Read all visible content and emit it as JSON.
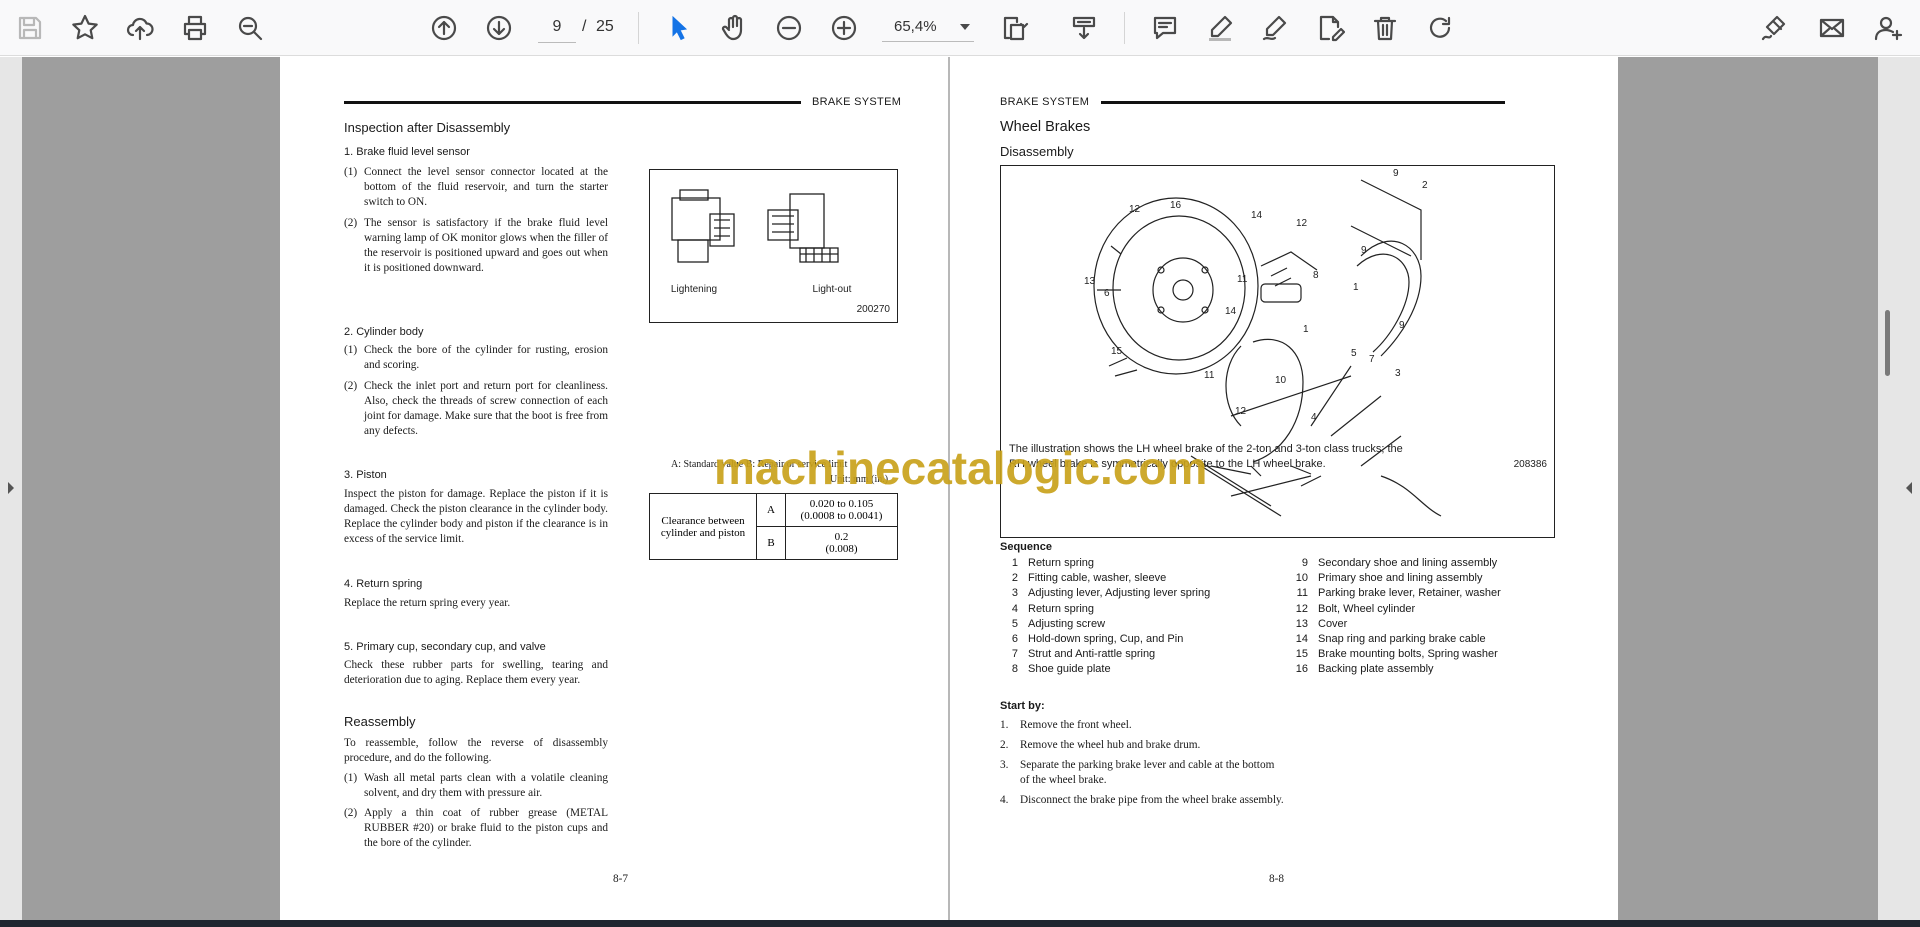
{
  "toolbar": {
    "page_current": "9",
    "page_separator": "/",
    "page_total": "25",
    "zoom": "65,4%"
  },
  "left_page": {
    "header": "BRAKE SYSTEM",
    "title": "Inspection after Disassembly",
    "s1_title": "1.   Brake fluid level sensor",
    "s1_p1_num": "(1)",
    "s1_p1": "Connect the level sensor connector located at the bottom of the fluid reservoir, and turn the starter switch to ON.",
    "s1_p2_num": "(2)",
    "s1_p2": "The sensor is satisfactory if the brake fluid level warning lamp of OK monitor glows when the filler of the reservoir is positioned upward and goes out when it is positioned downward.",
    "fig1_label_a": "Lightening",
    "fig1_label_b": "Light-out",
    "fig1_code": "200270",
    "s2_title": "2.   Cylinder body",
    "s2_p1_num": "(1)",
    "s2_p1": "Check the bore of the cylinder for rusting, erosion and scoring.",
    "s2_p2_num": "(2)",
    "s2_p2": "Check the inlet port and return port for cleanliness. Also, check the threads of screw connection of each joint for damage.  Make sure that the boot is free from any defects.",
    "s3_title": "3.   Piston",
    "s3_p": "Inspect the piston for damage.  Replace the piston if it is damaged.  Check the piston clearance in the cylinder body. Replace the cylinder body and piston if the clearance is in excess of the service limit.",
    "table_note1": "A:  Standard value    B: Repair or service limit",
    "table_note2": "Unit: mm (in.)",
    "table_label": "Clearance between cylinder and piston",
    "table_rows": [
      {
        "key": "A",
        "value1": "0.020 to 0.105",
        "value2": "(0.0008 to 0.0041)"
      },
      {
        "key": "B",
        "value1": "0.2",
        "value2": "(0.008)"
      }
    ],
    "s4_title": "4.   Return spring",
    "s4_p": "Replace the return spring every year.",
    "s5_title": "5.   Primary cup, secondary cup, and valve",
    "s5_p": "Check these rubber parts for swelling, tearing and deterioration due to aging.  Replace them every year.",
    "re_title": "Reassembly",
    "re_p": "To reassemble, follow the reverse of disassembly procedure, and do the following.",
    "re_p1_num": "(1)",
    "re_p1": "Wash all metal parts clean with a volatile cleaning solvent, and dry them with pressure air.",
    "re_p2_num": "(2)",
    "re_p2": "Apply a thin coat of rubber grease (METAL RUBBER #20) or brake fluid to the piston cups and the bore of the cylinder.",
    "page_number": "8-7"
  },
  "right_page": {
    "header": "BRAKE SYSTEM",
    "title": "Wheel Brakes",
    "subtitle": "Disassembly",
    "fig_caption_1": "The illustration shows the LH wheel brake of the 2-ton and 3-ton class trucks; the",
    "fig_caption_2": "RH wheel brake is symmetrically opposite to the LH wheel brake.",
    "fig_code": "208386",
    "sequence_title": "Sequence",
    "sequence_left": [
      {
        "n": "1",
        "t": "Return spring"
      },
      {
        "n": "2",
        "t": "Fitting cable, washer, sleeve"
      },
      {
        "n": "3",
        "t": "Adjusting lever, Adjusting lever spring"
      },
      {
        "n": "4",
        "t": "Return spring"
      },
      {
        "n": "5",
        "t": "Adjusting screw"
      },
      {
        "n": "6",
        "t": "Hold-down spring, Cup, and Pin"
      },
      {
        "n": "7",
        "t": "Strut and Anti-rattle spring"
      },
      {
        "n": "8",
        "t": "Shoe guide plate"
      }
    ],
    "sequence_right": [
      {
        "n": "9",
        "t": "Secondary shoe and lining assembly"
      },
      {
        "n": "10",
        "t": "Primary shoe and lining assembly"
      },
      {
        "n": "11",
        "t": "Parking brake lever, Retainer, washer"
      },
      {
        "n": "12",
        "t": "Bolt, Wheel cylinder"
      },
      {
        "n": "13",
        "t": "Cover"
      },
      {
        "n": "14",
        "t": "Snap ring and parking brake cable"
      },
      {
        "n": "15",
        "t": "Brake mounting bolts, Spring washer"
      },
      {
        "n": "16",
        "t": "Backing plate assembly"
      }
    ],
    "start_title": "Start by:",
    "start_items": [
      {
        "n": "1.",
        "t": "Remove the front wheel."
      },
      {
        "n": "2.",
        "t": "Remove the wheel hub and brake drum."
      },
      {
        "n": "3.",
        "t": "Separate the parking brake lever and cable at the bottom of the wheel brake."
      },
      {
        "n": "4.",
        "t": "Disconnect the brake pipe from the wheel brake assembly."
      }
    ],
    "page_number": "8-8",
    "diagram_labels": [
      "9",
      "2",
      "12",
      "16",
      "14",
      "12",
      "9",
      "13",
      "6",
      "11",
      "8",
      "1",
      "14",
      "1",
      "9",
      "5",
      "7",
      "3",
      "15",
      "11",
      "10",
      "4",
      "12"
    ]
  },
  "watermark": "machinecatalogic.com"
}
